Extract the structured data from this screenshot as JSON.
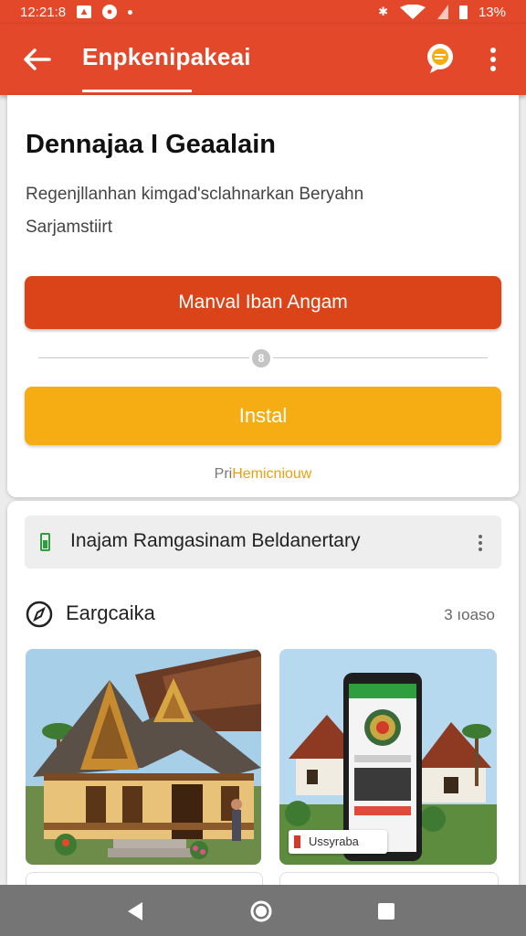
{
  "status_bar": {
    "time": "12:21:8",
    "battery": "13%",
    "icons": [
      "photo-icon",
      "pocket-icon",
      "dot-icon",
      "bluetooth-icon",
      "wifi-icon",
      "signal-icon",
      "battery-icon"
    ]
  },
  "app_bar": {
    "title": "Enpkenipakeai",
    "back_icon": "arrow-left-icon",
    "chat_icon": "chat-bubble-icon",
    "more_icon": "more-vertical-icon",
    "color": "#e4482a"
  },
  "main_card": {
    "heading": "Dennajaa I Geaalain",
    "description_line1": "Regenjllanhan kimgad'sclahnarkan Beryahn",
    "description_line2": "Sarjamstiirt",
    "primary_button": "Manval Iban Angam",
    "primary_color": "#db4418",
    "divider_badge": "8",
    "install_button": "Instal",
    "install_color": "#f6ad13",
    "footnote_prefix": "Pri",
    "footnote_accent": "Hemicniouw"
  },
  "list_card": {
    "banner_label": "Inajam Ramgasinam Beldanertary",
    "banner_icon": "phone-battery-icon",
    "section_title": "Eargcaika",
    "section_icon": "compass-icon",
    "section_count": "3 ıoaso",
    "thumbnails": [
      {
        "name": "traditional-house-photo"
      },
      {
        "name": "phone-app-photo",
        "chip_label": "Ussyraba"
      }
    ]
  },
  "nav_bar": {
    "back_icon": "nav-back-icon",
    "home_icon": "nav-home-icon",
    "recent_icon": "nav-recent-icon"
  }
}
